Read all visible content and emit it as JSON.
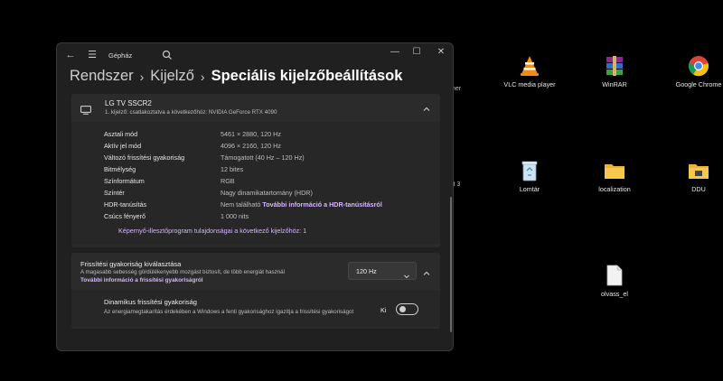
{
  "desktop": {
    "icons": [
      {
        "name": "vlc",
        "label": "VLC media player"
      },
      {
        "name": "winrar",
        "label": "WinRAR"
      },
      {
        "name": "chrome",
        "label": "Google Chrome"
      },
      {
        "name": "recycle",
        "label": "Lomtár"
      },
      {
        "name": "localization",
        "label": "localization"
      },
      {
        "name": "ddu",
        "label": "DDU"
      },
      {
        "name": "olvass",
        "label": "olvass_el"
      }
    ],
    "fragments": [
      "ner",
      "ct 3"
    ]
  },
  "window": {
    "app_title": "Gépház",
    "controls": {
      "minimize": "—",
      "maximize": "☐",
      "close": "✕"
    }
  },
  "breadcrumb": {
    "items": [
      "Rendszer",
      "Kijelző"
    ],
    "current": "Speciális kijelzőbeállítások",
    "separator": "›"
  },
  "display_card": {
    "name": "LG TV SSCR2",
    "subtitle": "1. kijelző: csatlakoztatva a következőhöz: NVIDIA GeForce RTX 4090",
    "rows": [
      {
        "label": "Asztali mód",
        "value": "5461 × 2880, 120 Hz"
      },
      {
        "label": "Aktív jel mód",
        "value": "4096 × 2160, 120 Hz"
      },
      {
        "label": "Változó frissítési gyakoriság",
        "value": "Támogatott (40 Hz – 120 Hz)"
      },
      {
        "label": "Bitmélység",
        "value": "12 bites"
      },
      {
        "label": "Színformátum",
        "value": "RGB"
      },
      {
        "label": "Színtér",
        "value": "Nagy dinamikatartomány (HDR)"
      },
      {
        "label": "HDR-tanúsítás",
        "value": "Nem található",
        "link": "További információ a HDR-tanúsításról"
      },
      {
        "label": "Csúcs fényerő",
        "value": "1 000 nits"
      }
    ],
    "adapter_link": "Képernyő-illesztőprogram tulajdonságai a következő kijelzőhöz: 1"
  },
  "refresh_card": {
    "title": "Frissítési gyakoriság kiválasztása",
    "description": "A magasabb sebesség gördülékenyebb mozgást biztosít, de több energiát használ",
    "link": "További információ a frissítési gyakoriságról",
    "selected": "120 Hz",
    "dynamic": {
      "title": "Dinamikus frissítési gyakoriság",
      "description": "Az energiamegtakarítás érdekében a Windows a fenti gyakorisághoz igazítja a frissítési gyakoriságot",
      "toggle_label": "Ki",
      "toggle_on": false
    }
  },
  "colors": {
    "window_bg": "#202020",
    "card_bg": "#2b2b2b",
    "link": "#d4b5ff"
  }
}
